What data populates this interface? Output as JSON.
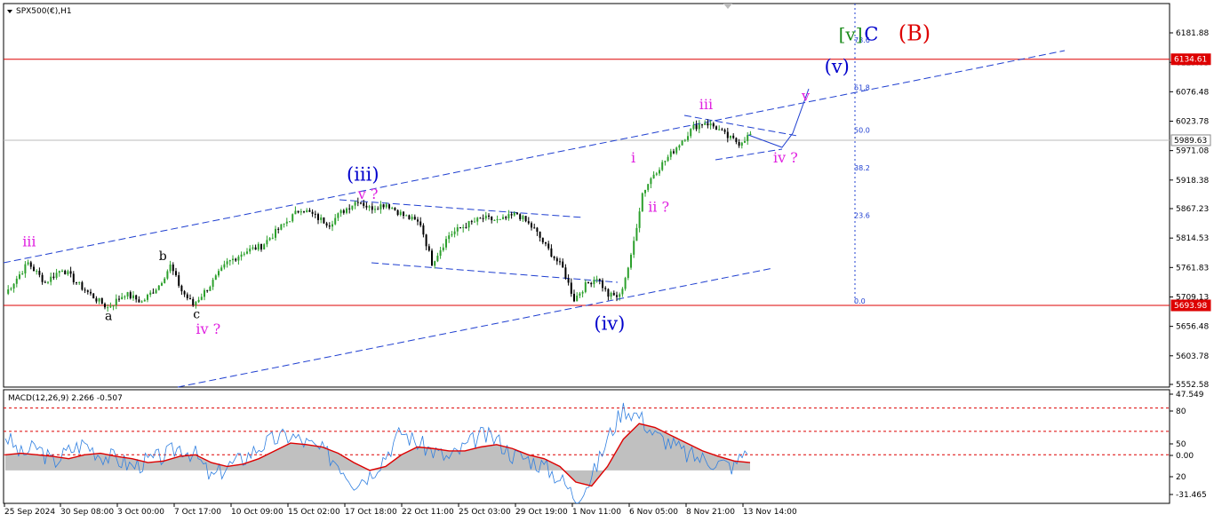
{
  "header": {
    "symbol_label": "SPX500(€),H1"
  },
  "macd_header": {
    "label": "MACD(12,26,9) 2.266 -0.507"
  },
  "colors": {
    "bull": "#2ca02c",
    "bear": "#000000",
    "wave_blue": "#0000cc",
    "wave_magenta": "#e020e0",
    "wave_green": "#1a8a1a",
    "wave_red": "#dd0000",
    "level_line": "#dd0000",
    "channel": "#1f3fd0",
    "macd_line": "#2f7fe0",
    "signal_line": "#dd0000",
    "histogram": "#c0c0c0"
  },
  "chart_data": [
    {
      "type": "candlestick",
      "title": "SPX500(€),H1",
      "price_axis_ticks": [
        "6181.88",
        "6129.03",
        "6076.48",
        "6023.78",
        "5971.08",
        "5918.38",
        "5867.23",
        "5814.53",
        "5761.83",
        "5709.13",
        "5656.48",
        "5603.78",
        "5552.58"
      ],
      "ylim": [
        5552.58,
        6211.0
      ],
      "time_axis_ticks": [
        "25 Sep 2024",
        "30 Sep 08:00",
        "3 Oct 00:00",
        "7 Oct 17:00",
        "10 Oct 09:00",
        "15 Oct 02:00",
        "17 Oct 18:00",
        "22 Oct 11:00",
        "25 Oct 03:00",
        "29 Oct 19:00",
        "1 Nov 11:00",
        "6 Nov 05:00",
        "8 Nov 21:00",
        "13 Nov 14:00"
      ],
      "current_price_label": "5989.63",
      "horizontal_levels": [
        {
          "value": 6134.61,
          "label": "6134.61"
        },
        {
          "value": 5693.98,
          "label": "5693.98"
        }
      ],
      "price_path": [
        [
          0,
          5715
        ],
        [
          8,
          5770
        ],
        [
          14,
          5735
        ],
        [
          20,
          5760
        ],
        [
          26,
          5730
        ],
        [
          32,
          5705
        ],
        [
          36,
          5690
        ],
        [
          42,
          5715
        ],
        [
          48,
          5700
        ],
        [
          54,
          5730
        ],
        [
          58,
          5765
        ],
        [
          62,
          5720
        ],
        [
          66,
          5695
        ],
        [
          72,
          5730
        ],
        [
          78,
          5770
        ],
        [
          84,
          5790
        ],
        [
          90,
          5800
        ],
        [
          96,
          5830
        ],
        [
          104,
          5868
        ],
        [
          110,
          5850
        ],
        [
          114,
          5840
        ],
        [
          118,
          5860
        ],
        [
          124,
          5883
        ],
        [
          128,
          5868
        ],
        [
          134,
          5876
        ],
        [
          140,
          5855
        ],
        [
          146,
          5840
        ],
        [
          150,
          5770
        ],
        [
          156,
          5820
        ],
        [
          162,
          5838
        ],
        [
          168,
          5850
        ],
        [
          174,
          5845
        ],
        [
          180,
          5858
        ],
        [
          186,
          5830
        ],
        [
          190,
          5800
        ],
        [
          196,
          5760
        ],
        [
          200,
          5705
        ],
        [
          204,
          5730
        ],
        [
          208,
          5745
        ],
        [
          212,
          5712
        ],
        [
          216,
          5710
        ],
        [
          220,
          5780
        ],
        [
          224,
          5895
        ],
        [
          228,
          5930
        ],
        [
          234,
          5965
        ],
        [
          238,
          5990
        ],
        [
          242,
          6013
        ],
        [
          246,
          6022
        ],
        [
          250,
          6012
        ],
        [
          254,
          5995
        ],
        [
          258,
          5985
        ],
        [
          262,
          6000
        ]
      ],
      "fibonacci": [
        {
          "value": 6161,
          "label": "78.6"
        },
        {
          "value": 6076,
          "label": "61.8"
        },
        {
          "value": 6000,
          "label": "50.0"
        },
        {
          "value": 5932,
          "label": "38.2"
        },
        {
          "value": 5847,
          "label": "23.6"
        },
        {
          "value": 5694,
          "label": "0.0"
        }
      ],
      "wave_labels": [
        {
          "text": "iii",
          "bar": 6,
          "price": 5800,
          "color": "magenta"
        },
        {
          "text": "a",
          "bar": 35,
          "price": 5668,
          "color": "black"
        },
        {
          "text": "b",
          "bar": 54,
          "price": 5775,
          "color": "black"
        },
        {
          "text": "c",
          "bar": 66,
          "price": 5671,
          "color": "black"
        },
        {
          "text": "iv ?",
          "bar": 67,
          "price": 5643,
          "color": "magenta"
        },
        {
          "text": "(iii)",
          "bar": 120,
          "price": 5917,
          "color": "blue"
        },
        {
          "text": "v ?",
          "bar": 124,
          "price": 5885,
          "color": "magenta"
        },
        {
          "text": "(iv)",
          "bar": 207,
          "price": 5650,
          "color": "blue"
        },
        {
          "text": "i",
          "bar": 220,
          "price": 5950,
          "color": "magenta"
        },
        {
          "text": "ii ?",
          "bar": 226,
          "price": 5862,
          "color": "magenta"
        },
        {
          "text": "iii",
          "bar": 244,
          "price": 6045,
          "color": "magenta"
        },
        {
          "text": "iv ?",
          "bar": 270,
          "price": 5950,
          "color": "magenta"
        },
        {
          "text": "v",
          "bar": 280,
          "price": 6060,
          "color": "magenta"
        },
        {
          "text": "(v)",
          "bar": 288,
          "price": 6110,
          "color": "blue"
        },
        {
          "text": "[v]",
          "bar": 293,
          "price": 6168,
          "color": "green"
        },
        {
          "text": "C",
          "bar": 302,
          "price": 6168,
          "color": "blue"
        },
        {
          "text": "(B)",
          "bar": 314,
          "price": 6168,
          "color": "red"
        }
      ]
    },
    {
      "type": "line",
      "title": "MACD(12,26,9) 2.266 -0.507",
      "axis_ticks": [
        "47.549",
        "80",
        "50",
        "0.00",
        "20",
        "-31.465"
      ],
      "dashed_levels": [
        80,
        50,
        20
      ],
      "ylim": [
        -40,
        100
      ],
      "series": [
        {
          "name": "MACD",
          "values": [
            45,
            20,
            30,
            10,
            25,
            35,
            20,
            15,
            5,
            12,
            18,
            30,
            20,
            -10,
            5,
            15,
            30,
            40,
            45,
            35,
            25,
            10,
            -15,
            -5,
            20,
            50,
            35,
            25,
            15,
            30,
            45,
            40,
            20,
            15,
            5,
            -10,
            -35,
            -10,
            40,
            80,
            70,
            45,
            35,
            20,
            15,
            10,
            5,
            35
          ]
        },
        {
          "name": "Signal",
          "values": [
            20,
            22,
            20,
            18,
            15,
            20,
            22,
            18,
            15,
            10,
            12,
            18,
            20,
            10,
            5,
            8,
            15,
            25,
            35,
            33,
            30,
            22,
            10,
            0,
            5,
            20,
            30,
            28,
            25,
            25,
            30,
            33,
            28,
            20,
            15,
            5,
            -15,
            -20,
            5,
            40,
            60,
            55,
            45,
            35,
            25,
            18,
            12,
            10
          ]
        }
      ]
    }
  ]
}
